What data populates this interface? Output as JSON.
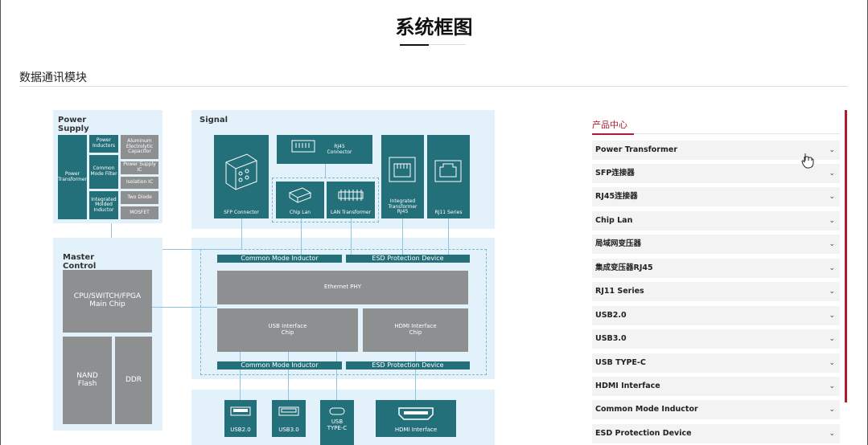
{
  "page": {
    "title": "系统框图",
    "section": "数据通讯模块"
  },
  "diagram": {
    "power_supply": {
      "title": "Power Supply",
      "power_transformer": "Power Transformer",
      "power_inductors": "Power Inductors",
      "common_mode_filter": "Common Mode Filter",
      "integrated_molded_inductor": "Integrated Molded Inductor",
      "aluminum_capacitor": "Aluminum Electrolytic Capacitor",
      "power_supply_ic": "Power Supply IC",
      "isolation_ic": "Isolation IC",
      "two_diode": "Two Diode",
      "mosfet": "MOSFET"
    },
    "signal": {
      "title": "Signal",
      "sfp_connector": "SFP Connector",
      "rj45_connector": "RJ45 Connector",
      "chip_lan": "Chip Lan",
      "lan_transformer": "LAN Transformer",
      "integrated_transformer_rj45": "Integrated Transformer RJ45",
      "rj11_series": "RJ11 Series"
    },
    "master_control": {
      "title": "Master Control",
      "cpu": "CPU/SWITCH/FPGA Main Chip",
      "nand": "NAND Flash",
      "ddr": "DDR"
    },
    "interface": {
      "common_mode_inductor_top": "Common Mode Inductor",
      "esd_top": "ESD Protection Device",
      "ethernet_phy": "Ethernet PHY",
      "usb_chip": "USB Interface Chip",
      "hdmi_chip": "HDMI Interface Chip",
      "common_mode_inductor_bottom": "Common Mode Inductor",
      "esd_bottom": "ESD Protection Device"
    },
    "ports": {
      "usb20": "USB2.0",
      "usb30": "USB3.0",
      "usbc": "USB TYPE-C",
      "hdmi": "HDMI Interface"
    }
  },
  "sidebar": {
    "heading": "产品中心",
    "items": [
      {
        "label": "Power Transformer"
      },
      {
        "label": "SFP连接器"
      },
      {
        "label": "RJ45连接器"
      },
      {
        "label": "Chip Lan"
      },
      {
        "label": "局域网变压器"
      },
      {
        "label": "集成变压器RJ45"
      },
      {
        "label": "RJ11 Series"
      },
      {
        "label": "USB2.0"
      },
      {
        "label": "USB3.0"
      },
      {
        "label": "USB TYPE-C"
      },
      {
        "label": "HDMI Interface"
      },
      {
        "label": "Common Mode Inductor"
      },
      {
        "label": "ESD Protection Device"
      }
    ],
    "chevron": "⌄"
  },
  "colors": {
    "accent": "#b01c2e",
    "teal": "#236f7a",
    "panel": "#e3f2fa",
    "chip_grey": "#8d8f91"
  }
}
